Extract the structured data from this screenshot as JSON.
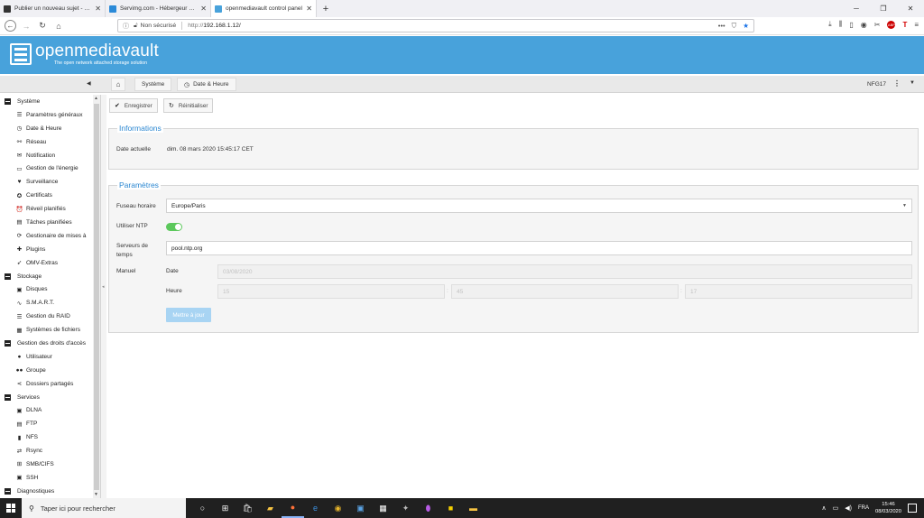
{
  "browser": {
    "tabs": [
      {
        "label": "Publier un nouveau sujet - Foru",
        "favicon_color": "#333333",
        "active": false
      },
      {
        "label": "Servimg.com - Hébergeur gratu",
        "favicon_color": "#2b8ad8",
        "active": false
      },
      {
        "label": "openmediavault control panel",
        "favicon_color": "#48a2db",
        "active": true
      }
    ],
    "new_tab_glyph": "+",
    "security_label": "Non sécurisé",
    "url_prefix": "http://",
    "url_host": "192.168.1.12/"
  },
  "app": {
    "title": "openmediavault",
    "subtitle": "The open network attached storage solution",
    "brand_color": "#48a2db",
    "hostname": "NFG17"
  },
  "breadcrumb": {
    "items": [
      {
        "label": "Système"
      },
      {
        "label": "Date & Heure"
      }
    ]
  },
  "sidebar": {
    "groups": [
      {
        "label": "Système",
        "items": [
          {
            "label": "Paramètres généraux",
            "icon": "sliders-icon",
            "glyph": "☰"
          },
          {
            "label": "Date & Heure",
            "icon": "clock-icon",
            "glyph": "◷"
          },
          {
            "label": "Réseau",
            "icon": "network-icon",
            "glyph": "⚯"
          },
          {
            "label": "Notification",
            "icon": "envelope-icon",
            "glyph": "✉"
          },
          {
            "label": "Gestion de l'énergie",
            "icon": "battery-icon",
            "glyph": "▭"
          },
          {
            "label": "Surveillance",
            "icon": "heartbeat-icon",
            "glyph": "♥"
          },
          {
            "label": "Certificats",
            "icon": "certificate-icon",
            "glyph": "✪"
          },
          {
            "label": "Réveil planifiés",
            "icon": "alarm-icon",
            "glyph": "⏰"
          },
          {
            "label": "Tâches planifiées",
            "icon": "tasks-icon",
            "glyph": "▤"
          },
          {
            "label": "Gestionaire de mises à",
            "icon": "refresh-icon",
            "glyph": "⟳"
          },
          {
            "label": "Plugins",
            "icon": "puzzle-icon",
            "glyph": "✚"
          },
          {
            "label": "OMV-Extras",
            "icon": "rocket-icon",
            "glyph": "➶"
          }
        ]
      },
      {
        "label": "Stockage",
        "items": [
          {
            "label": "Disques",
            "icon": "disk-icon",
            "glyph": "▣"
          },
          {
            "label": "S.M.A.R.T.",
            "icon": "pulse-icon",
            "glyph": "∿"
          },
          {
            "label": "Gestion du RAID",
            "icon": "raid-icon",
            "glyph": "☰"
          },
          {
            "label": "Systèmes de fichiers",
            "icon": "filesystem-icon",
            "glyph": "▦"
          }
        ]
      },
      {
        "label": "Gestion des droits d'accès",
        "items": [
          {
            "label": "Utilisateur",
            "icon": "user-icon",
            "glyph": "●"
          },
          {
            "label": "Groupe",
            "icon": "users-icon",
            "glyph": "●●"
          },
          {
            "label": "Dossiers partagés",
            "icon": "share-icon",
            "glyph": "⋖"
          }
        ]
      },
      {
        "label": "Services",
        "items": [
          {
            "label": "DLNA",
            "icon": "dlna-icon",
            "glyph": "▣"
          },
          {
            "label": "FTP",
            "icon": "ftp-icon",
            "glyph": "▤"
          },
          {
            "label": "NFS",
            "icon": "nfs-icon",
            "glyph": "▮"
          },
          {
            "label": "Rsync",
            "icon": "rsync-icon",
            "glyph": "⇄"
          },
          {
            "label": "SMB/CIFS",
            "icon": "windows-icon",
            "glyph": "⊞"
          },
          {
            "label": "SSH",
            "icon": "terminal-icon",
            "glyph": "▣"
          }
        ]
      },
      {
        "label": "Diagnostiques",
        "items": []
      }
    ]
  },
  "toolbar": {
    "save_label": "Enregistrer",
    "reset_label": "Réinitialiser"
  },
  "info": {
    "legend": "Informations",
    "current_date_label": "Date actuelle",
    "current_date_value": "dim. 08 mars 2020 15:45:17 CET"
  },
  "params": {
    "legend": "Paramètres",
    "timezone_label": "Fuseau horaire",
    "timezone_value": "Europe/Paris",
    "ntp_label": "Utiliser NTP",
    "ntp_enabled": true,
    "servers_label": "Serveurs de temps",
    "servers_value": "pool.ntp.org",
    "manual_label": "Manuel",
    "date_label": "Date",
    "date_value": "03/08/2020",
    "time_label": "Heure",
    "hour_value": "15",
    "minute_value": "45",
    "second_value": "17",
    "time_separator": ":",
    "sync_button_label": "Mettre à jour"
  },
  "taskbar": {
    "search_placeholder": "Taper ici pour rechercher",
    "time": "15:46",
    "date": "08/03/2020",
    "lang": "FRA"
  }
}
